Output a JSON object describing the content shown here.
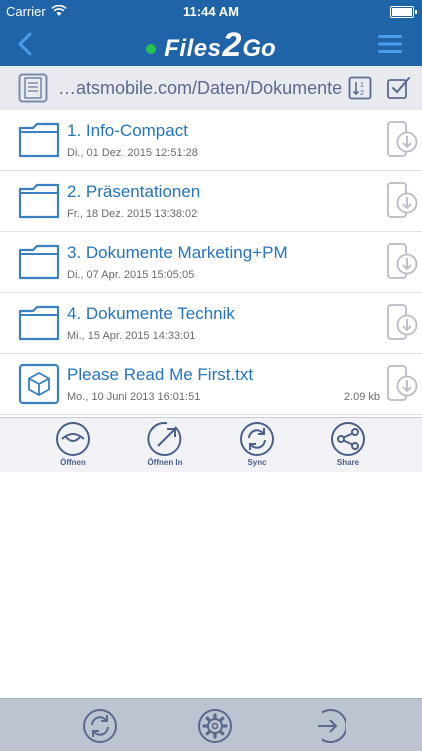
{
  "status": {
    "carrier": "Carrier",
    "time": "11:44 AM",
    "battery_level": 1.0
  },
  "header": {
    "brand_part1": "Files",
    "brand_part2": "2",
    "brand_part3": "Go"
  },
  "pathbar": {
    "path": "…atsmobile.com/Daten/Dokumente"
  },
  "items": [
    {
      "name": "1. Info-Compact",
      "date": "Di., 01 Dez. 2015 12:51:28",
      "size": "",
      "type": "folder"
    },
    {
      "name": "2. Präsentationen",
      "date": "Fr., 18 Dez. 2015 13:38:02",
      "size": "",
      "type": "folder"
    },
    {
      "name": "3. Dokumente Marketing+PM",
      "date": "Di., 07 Apr. 2015 15:05:05",
      "size": "",
      "type": "folder"
    },
    {
      "name": "4. Dokumente Technik",
      "date": "Mi., 15 Apr. 2015 14:33:01",
      "size": "",
      "type": "folder"
    },
    {
      "name": "Please Read Me First.txt",
      "date": "Mo., 10 Juni 2013 16:01:51",
      "size": "2.09 kb",
      "type": "file"
    }
  ],
  "actions": [
    {
      "label": "Öffnen",
      "icon": "eye-icon"
    },
    {
      "label": "Öffnen In",
      "icon": "open-in-icon"
    },
    {
      "label": "Sync",
      "icon": "sync-icon"
    },
    {
      "label": "Share",
      "icon": "share-icon"
    }
  ],
  "tabs": [
    {
      "icon": "sync-icon"
    },
    {
      "icon": "gear-icon"
    },
    {
      "icon": "logout-icon"
    }
  ],
  "colors": {
    "nav": "#1f63a8",
    "accent_text": "#2574bd",
    "icon_blue": "#3a7fc0",
    "status_dot": "#27c24c",
    "tabbar": "#bcc3d1"
  }
}
